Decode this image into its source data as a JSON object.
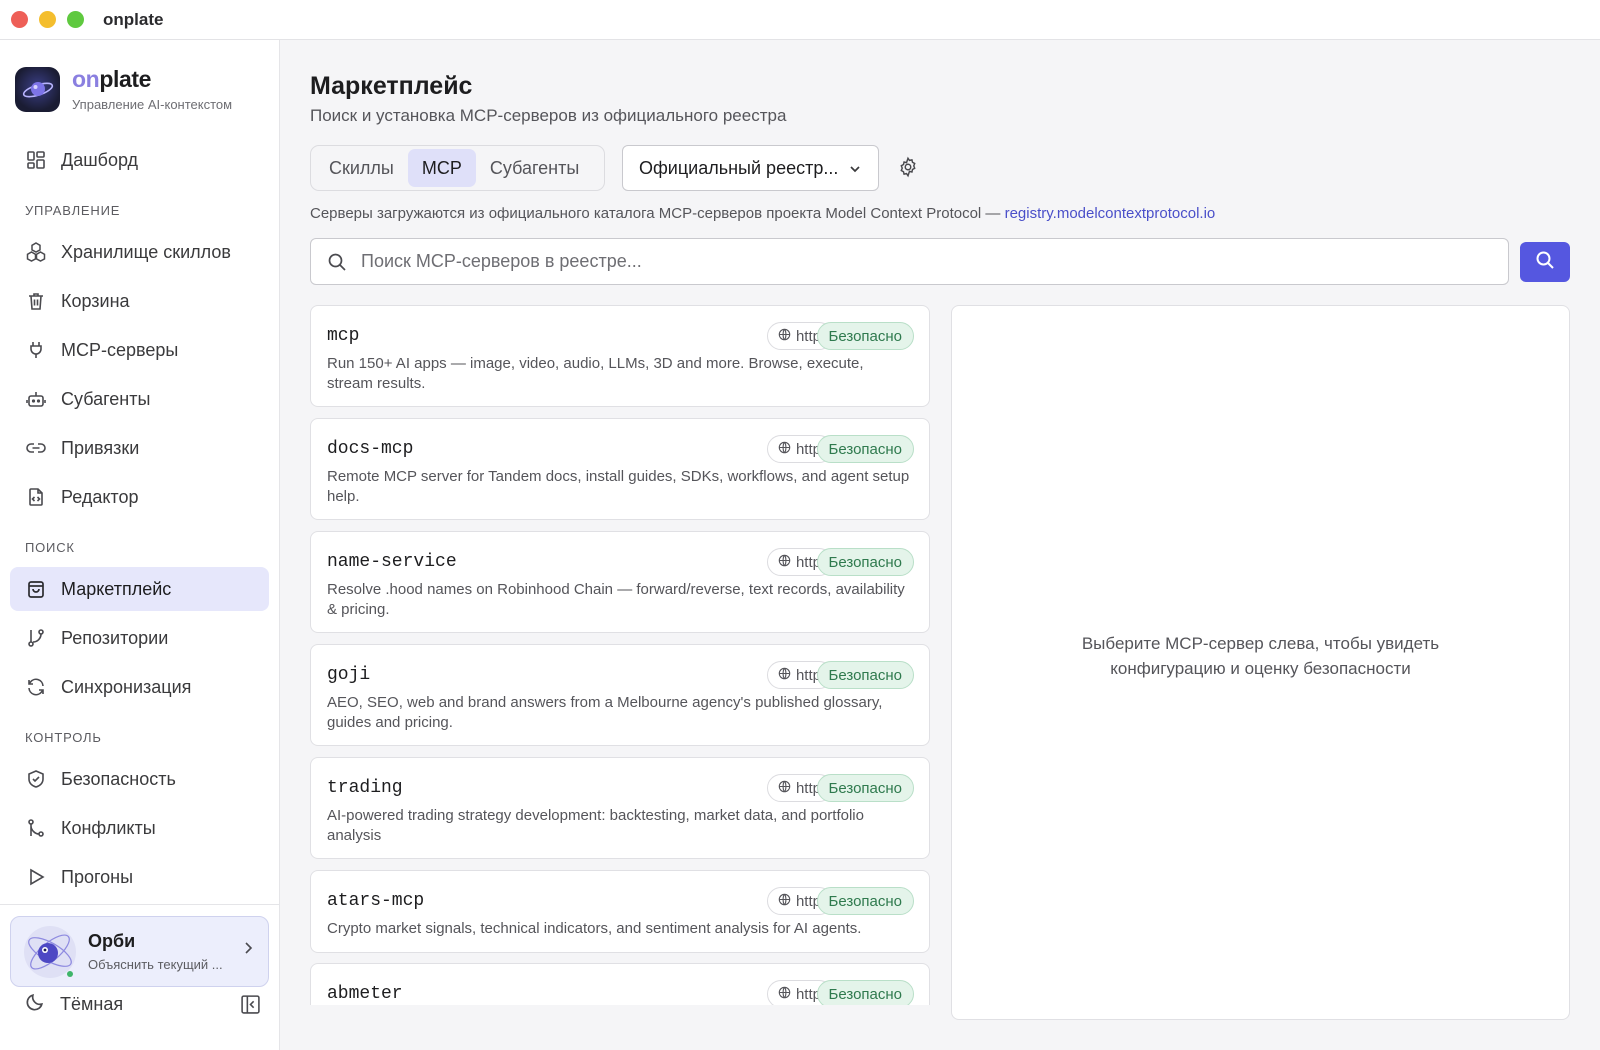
{
  "window": {
    "title": "onplate"
  },
  "brand": {
    "name_accent": "on",
    "name_rest": "plate",
    "subtitle": "Управление AI-контекстом"
  },
  "sidebar": {
    "dashboard": "Дашборд",
    "sections": {
      "manage": "УПРАВЛЕНИЕ",
      "search": "ПОИСК",
      "control": "КОНТРОЛЬ"
    },
    "manage_items": [
      "Хранилище скиллов",
      "Корзина",
      "MCP-серверы",
      "Субагенты",
      "Привязки",
      "Редактор"
    ],
    "search_items": [
      "Маркетплейс",
      "Репозитории",
      "Синхронизация"
    ],
    "control_items": [
      "Безопасность",
      "Конфликты",
      "Прогоны"
    ],
    "active_item": "Маркетплейс"
  },
  "assistant": {
    "name": "Орби",
    "subtitle": "Объяснить текущий ..."
  },
  "theme": {
    "label": "Тёмная"
  },
  "page": {
    "title": "Маркетплейс",
    "subtitle": "Поиск и установка MCP-серверов из официального реестра",
    "tabs": [
      "Скиллы",
      "MCP",
      "Субагенты"
    ],
    "active_tab": "MCP",
    "registry_select": "Официальный реестр...",
    "info_text": "Серверы загружаются из официального каталога MCP-серверов проекта Model Context Protocol — ",
    "info_link": "registry.modelcontextprotocol.io",
    "search_placeholder": "Поиск MCP-серверов в реестре..."
  },
  "servers": [
    {
      "name": "mcp",
      "transport": "http",
      "status": "Безопасно",
      "description": "Run 150+ AI apps — image, video, audio, LLMs, 3D and more. Browse, execute, stream results."
    },
    {
      "name": "docs-mcp",
      "transport": "http",
      "status": "Безопасно",
      "description": "Remote MCP server for Tandem docs, install guides, SDKs, workflows, and agent setup help."
    },
    {
      "name": "name-service",
      "transport": "http",
      "status": "Безопасно",
      "description": "Resolve .hood names on Robinhood Chain — forward/reverse, text records, availability & pricing."
    },
    {
      "name": "goji",
      "transport": "http",
      "status": "Безопасно",
      "description": "AEO, SEO, web and brand answers from a Melbourne agency's published glossary, guides and pricing."
    },
    {
      "name": "trading",
      "transport": "http",
      "status": "Безопасно",
      "description": "AI-powered trading strategy development: backtesting, market data, and portfolio analysis"
    },
    {
      "name": "atars-mcp",
      "transport": "http",
      "status": "Безопасно",
      "description": "Crypto market signals, technical indicators, and sentiment analysis for AI agents."
    },
    {
      "name": "abmeter",
      "transport": "http",
      "status": "Безопасно",
      "description": ""
    }
  ],
  "detail": {
    "empty_line1": "Выберите MCP-сервер слева, чтобы увидеть",
    "empty_line2": "конфигурацию и оценку безопасности"
  },
  "colors": {
    "accent": "#5557e0",
    "safe_bg": "#e4f4ea",
    "safe_text": "#2f7a4e",
    "active_nav": "#e6e7fb"
  }
}
